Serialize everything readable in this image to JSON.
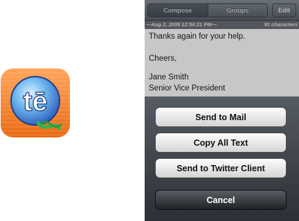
{
  "app_icon": {
    "name": "te-app-icon",
    "glyph": "tē",
    "colors": {
      "background": "#f47a1f",
      "globe": "#3b7fd1",
      "ribbon": "#39b54a"
    }
  },
  "toolbar": {
    "segments": [
      {
        "label": "Compose",
        "active": true
      },
      {
        "label": "Groups",
        "active": false
      }
    ],
    "edit_label": "Edit"
  },
  "note": {
    "date": "—Aug 2, 2009 12:54:21 PM—",
    "char_count": "91 characters",
    "lines": [
      "Thanks again for your help.",
      "",
      "Cheers,",
      "",
      "Jane Smith",
      "Senior Vice President"
    ]
  },
  "action_sheet": {
    "buttons": [
      {
        "label": "Send to Mail"
      },
      {
        "label": "Copy All Text"
      },
      {
        "label": "Send to Twitter Client"
      }
    ],
    "cancel_label": "Cancel"
  }
}
